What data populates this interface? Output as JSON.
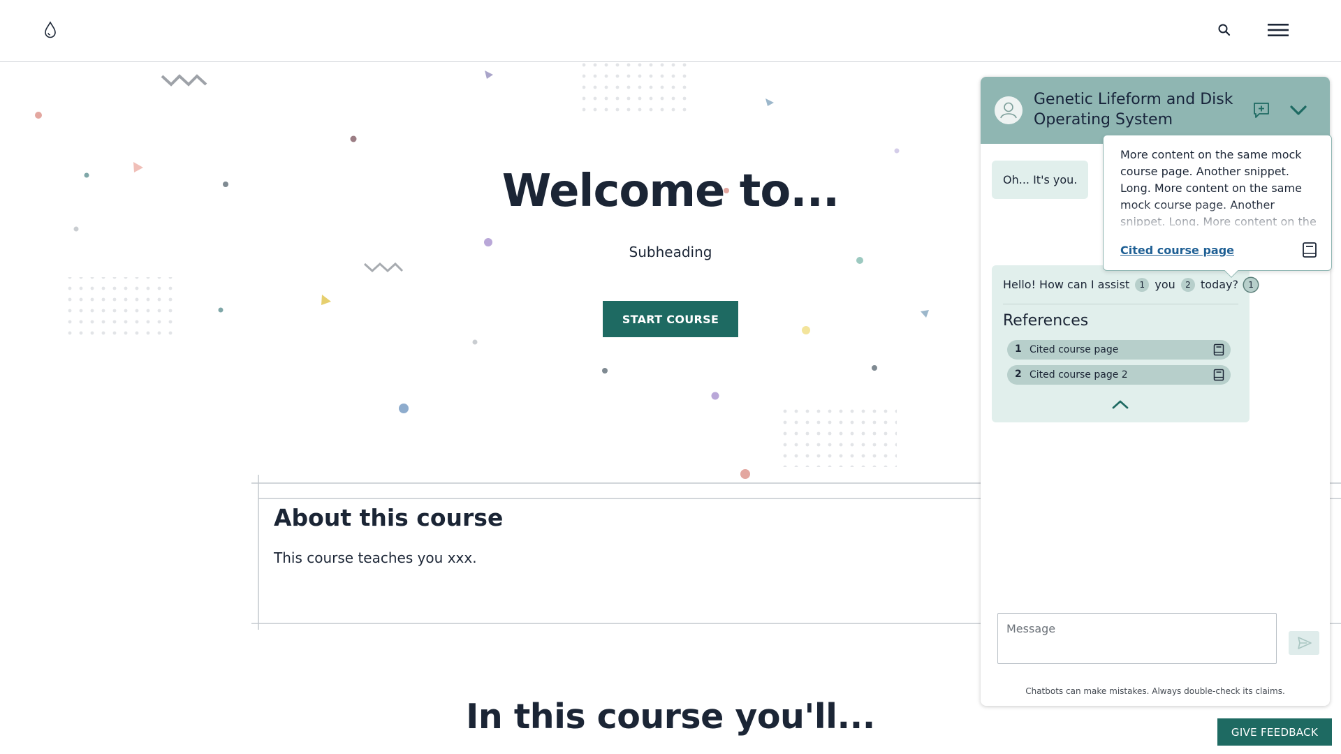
{
  "header": {
    "logo_icon": "droplet-icon",
    "search_icon": "search-icon",
    "menu_icon": "hamburger-menu-icon"
  },
  "hero": {
    "title": "Welcome to...",
    "subheading": "Subheading",
    "start_label": "START COURSE"
  },
  "about": {
    "title": "About this course",
    "text": "This course teaches you xxx."
  },
  "learn": {
    "title": "In this course you'll..."
  },
  "chat": {
    "title": "Genetic Lifeform and Disk Operating System",
    "new_chat_icon": "new-chat-icon",
    "collapse_icon": "chevron-down-icon",
    "user_message": "Oh... It's you.",
    "bot_message": {
      "parts": [
        "Hello! How can I assist",
        "you",
        "today?"
      ],
      "citations": [
        "1",
        "2",
        "1"
      ]
    },
    "references_title": "References",
    "references": [
      {
        "num": "1",
        "label": "Cited course page"
      },
      {
        "num": "2",
        "label": "Cited course page 2"
      }
    ],
    "popover": {
      "text": "More content on the same mock course page. Another snippet. Long. More content on the same mock course page. Another snippet. Long. More content on the same mock course page. Another snippet. Long.",
      "link_label": "Cited course page",
      "icon": "book-icon"
    },
    "input_placeholder": "Message",
    "send_icon": "send-icon",
    "disclaimer": "Chatbots can make mistakes. Always double-check its claims."
  },
  "feedback": {
    "label": "GIVE FEEDBACK"
  },
  "colors": {
    "brand": "#1e6a62",
    "chat_header": "#8fb6b2",
    "bubble": "#e1efec",
    "chip": "#b7cfcb",
    "text": "#1b2535",
    "link": "#1e5f94"
  }
}
